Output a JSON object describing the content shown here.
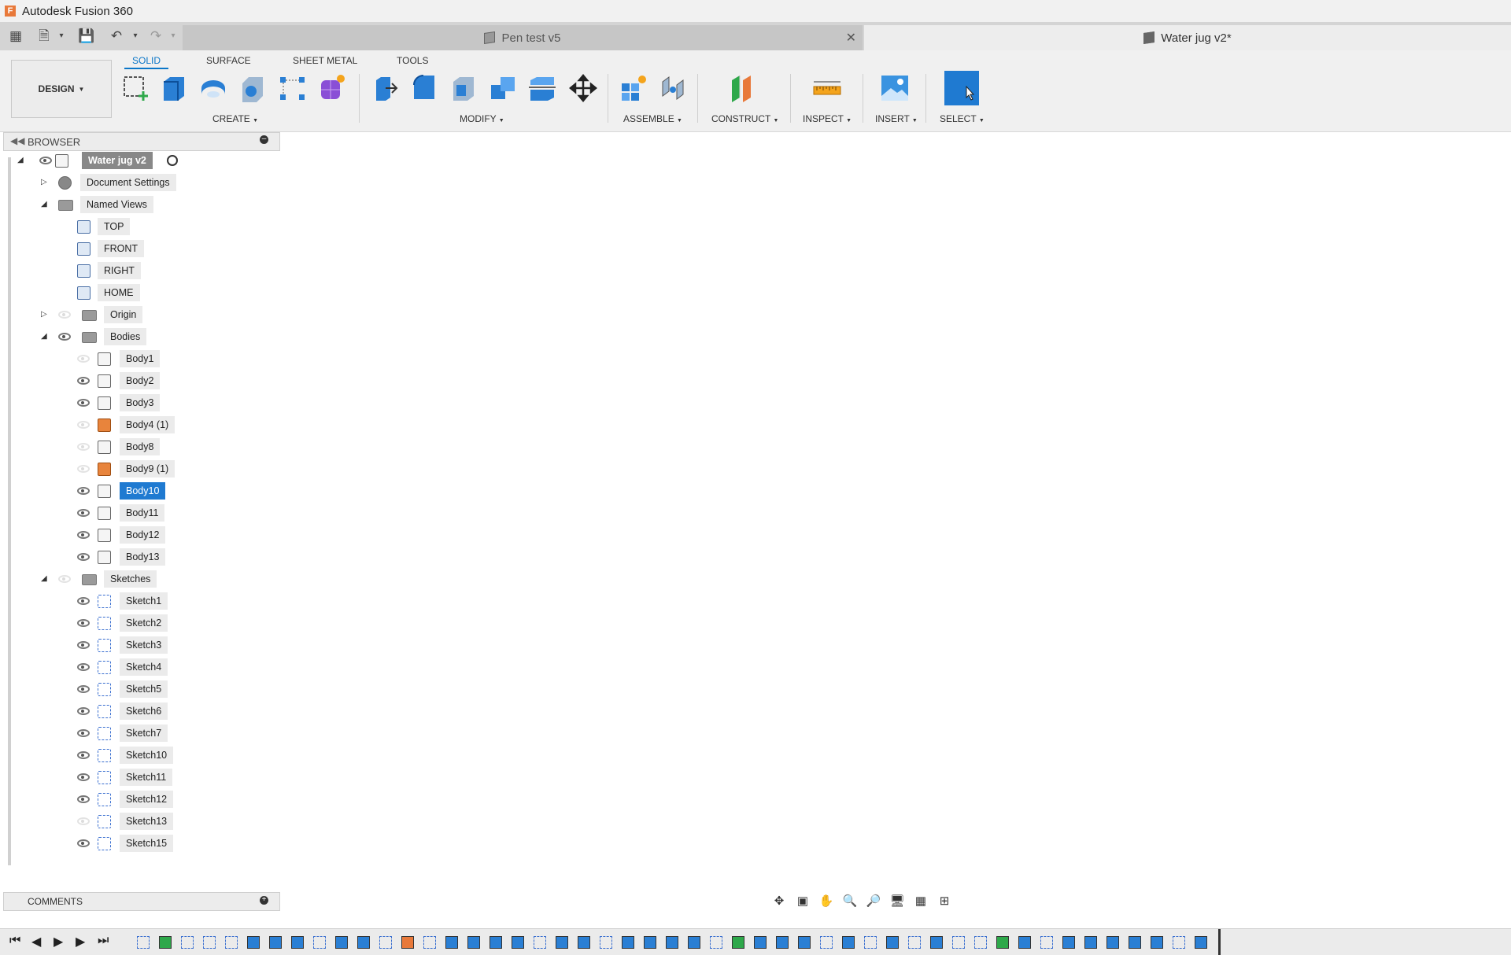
{
  "app": {
    "title": "Autodesk Fusion 360"
  },
  "tabs": [
    {
      "label": "Pen test v5",
      "active": false
    },
    {
      "label": "Water jug v2*",
      "active": true
    }
  ],
  "workspace": {
    "label": "DESIGN"
  },
  "toolbar_tabs": [
    "SOLID",
    "SURFACE",
    "SHEET METAL",
    "TOOLS"
  ],
  "groups": {
    "create": "CREATE",
    "modify": "MODIFY",
    "assemble": "ASSEMBLE",
    "construct": "CONSTRUCT",
    "inspect": "INSPECT",
    "insert": "INSERT",
    "select": "SELECT"
  },
  "browser": {
    "title": "BROWSER",
    "root": "Water jug v2",
    "items": [
      {
        "label": "Document Settings",
        "type": "settings"
      },
      {
        "label": "Named Views",
        "type": "folder"
      },
      {
        "label": "TOP",
        "type": "view"
      },
      {
        "label": "FRONT",
        "type": "view"
      },
      {
        "label": "RIGHT",
        "type": "view"
      },
      {
        "label": "HOME",
        "type": "view"
      },
      {
        "label": "Origin",
        "type": "folder"
      },
      {
        "label": "Bodies",
        "type": "folder"
      },
      {
        "label": "Body1",
        "type": "body",
        "visible": false
      },
      {
        "label": "Body2",
        "type": "body",
        "visible": true
      },
      {
        "label": "Body3",
        "type": "body",
        "visible": true
      },
      {
        "label": "Body4 (1)",
        "type": "comp",
        "visible": false
      },
      {
        "label": "Body8",
        "type": "body",
        "visible": false
      },
      {
        "label": "Body9 (1)",
        "type": "comp",
        "visible": false
      },
      {
        "label": "Body10",
        "type": "body",
        "visible": true,
        "selected": true
      },
      {
        "label": "Body11",
        "type": "body",
        "visible": true
      },
      {
        "label": "Body12",
        "type": "body",
        "visible": true
      },
      {
        "label": "Body13",
        "type": "body",
        "visible": true
      },
      {
        "label": "Sketches",
        "type": "folder"
      },
      {
        "label": "Sketch1",
        "type": "sketch",
        "visible": true
      },
      {
        "label": "Sketch2",
        "type": "sketch",
        "visible": true
      },
      {
        "label": "Sketch3",
        "type": "sketch",
        "visible": true
      },
      {
        "label": "Sketch4",
        "type": "sketch",
        "visible": true
      },
      {
        "label": "Sketch5",
        "type": "sketch",
        "visible": true
      },
      {
        "label": "Sketch6",
        "type": "sketch",
        "visible": true
      },
      {
        "label": "Sketch7",
        "type": "sketch",
        "visible": true
      },
      {
        "label": "Sketch10",
        "type": "sketch",
        "visible": true
      },
      {
        "label": "Sketch11",
        "type": "sketch",
        "visible": true
      },
      {
        "label": "Sketch12",
        "type": "sketch",
        "visible": true
      },
      {
        "label": "Sketch13",
        "type": "sketch",
        "visible": false
      },
      {
        "label": "Sketch15",
        "type": "sketch",
        "visible": true
      }
    ]
  },
  "comments": {
    "title": "COMMENTS"
  },
  "colors": {
    "accent": "#0b76c8",
    "selection": "#1f7ad1",
    "tank_blue": "#2e8da8",
    "body_grey": "#c8c8c8"
  }
}
